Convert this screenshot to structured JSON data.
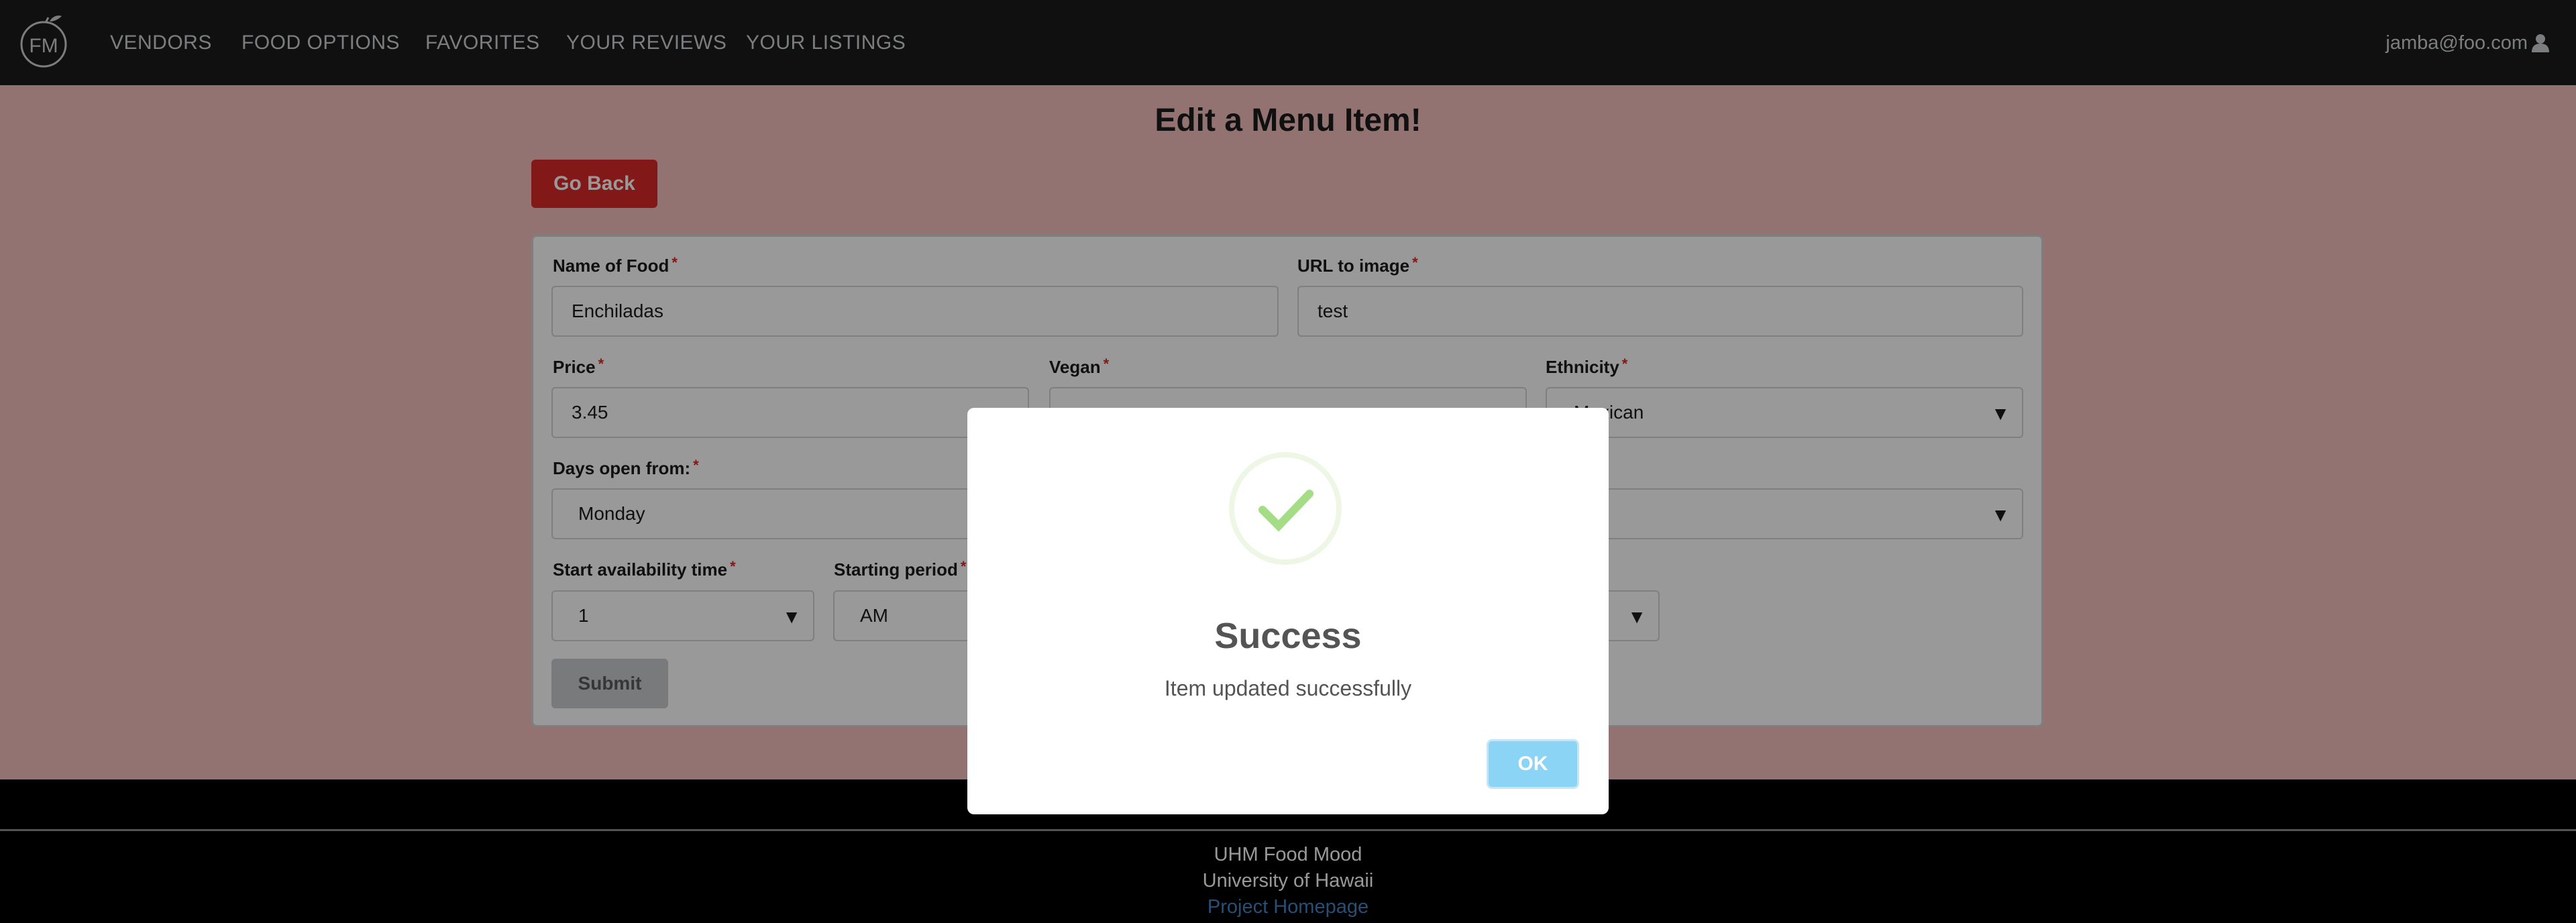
{
  "nav": {
    "logo_text": "FM",
    "items": [
      "VENDORS",
      "FOOD OPTIONS",
      "FAVORITES",
      "YOUR REVIEWS",
      "YOUR LISTINGS"
    ],
    "user_email": "jamba@foo.com",
    "user_icon": "user-icon"
  },
  "page": {
    "title": "Edit a Menu Item!",
    "go_back_label": "Go Back"
  },
  "form": {
    "name_label": "Name of Food",
    "name_value": "Enchiladas",
    "url_label": "URL to image",
    "url_value": "test",
    "price_label": "Price",
    "price_value": "3.45",
    "vegan_label": "Vegan",
    "vegan_value": "",
    "ethnicity_label": "Ethnicity",
    "ethnicity_value": "Mexican",
    "days_label": "Days open from:",
    "days_value": "Monday",
    "days_to_value": "",
    "start_time_label": "Start availability time",
    "start_time_value": "1",
    "start_period_label": "Starting period",
    "start_period_value": "AM",
    "end_value": "",
    "required_mark": "*",
    "submit_label": "Submit"
  },
  "modal": {
    "icon": "success-check-icon",
    "title": "Success",
    "message": "Item updated successfully",
    "ok_label": "OK"
  },
  "footer": {
    "line1": "UHM Food Mood",
    "line2": "University of Hawaii",
    "link": "Project Homepage"
  }
}
